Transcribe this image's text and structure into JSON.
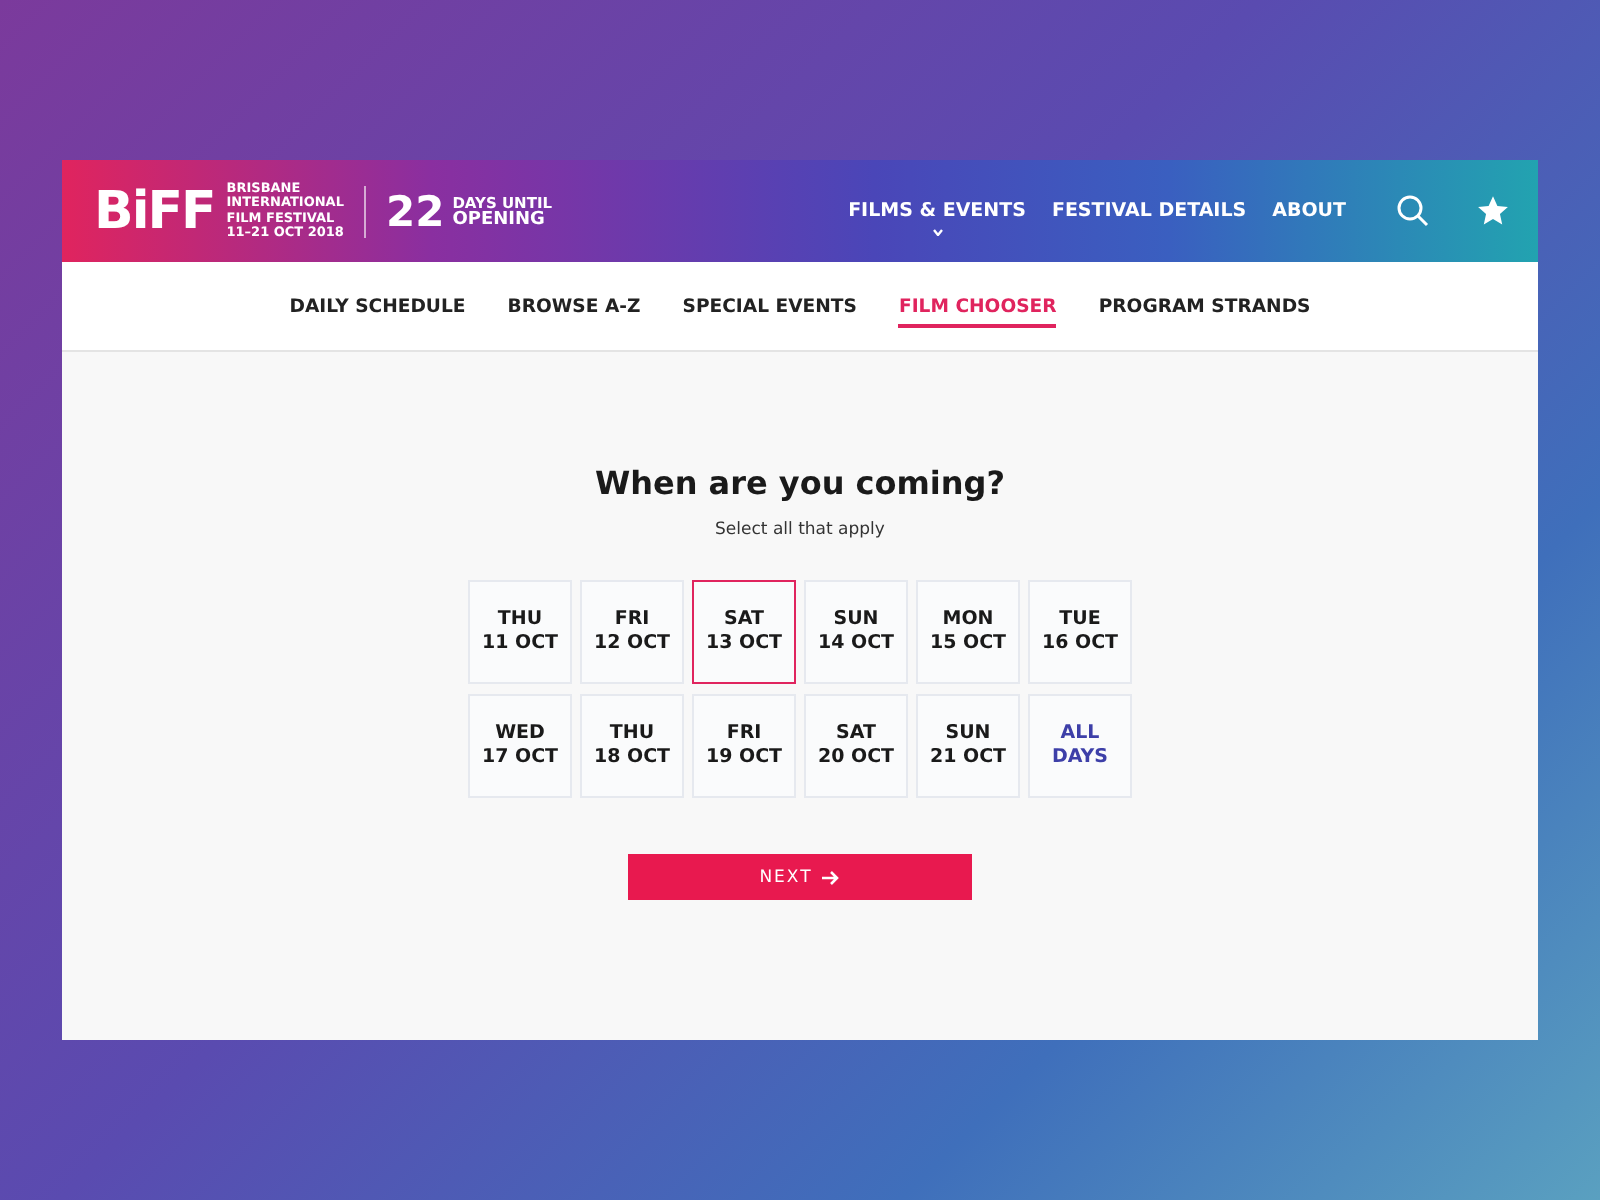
{
  "header": {
    "logo": "BiFF",
    "festival_lines": [
      "BRISBANE",
      "INTERNATIONAL",
      "FILM FESTIVAL",
      "11–21 OCT 2018"
    ],
    "countdown_number": "22",
    "countdown_lines": [
      "DAYS UNTIL",
      "OPENING"
    ],
    "nav": [
      {
        "label": "FILMS & EVENTS",
        "expanded": false
      },
      {
        "label": "FESTIVAL DETAILS"
      },
      {
        "label": "ABOUT"
      }
    ]
  },
  "subnav": [
    {
      "label": "DAILY SCHEDULE",
      "selected": false
    },
    {
      "label": "BROWSE A-Z",
      "selected": false
    },
    {
      "label": "SPECIAL EVENTS",
      "selected": false
    },
    {
      "label": "FILM CHOOSER",
      "selected": true
    },
    {
      "label": "PROGRAM STRANDS",
      "selected": false
    }
  ],
  "chooser": {
    "title": "When are you coming?",
    "subtitle": "Select all that apply",
    "days": [
      {
        "kind": "day",
        "lines": [
          "THU",
          "11 OCT"
        ],
        "selected": false
      },
      {
        "kind": "day",
        "lines": [
          "FRI",
          "12 OCT"
        ],
        "selected": false
      },
      {
        "kind": "day",
        "lines": [
          "SAT",
          "13 OCT"
        ],
        "selected": true
      },
      {
        "kind": "day",
        "lines": [
          "SUN",
          "14 OCT"
        ],
        "selected": false
      },
      {
        "kind": "day",
        "lines": [
          "MON",
          "15 OCT"
        ],
        "selected": false
      },
      {
        "kind": "day",
        "lines": [
          "TUE",
          "16 OCT"
        ],
        "selected": false
      },
      {
        "kind": "day",
        "lines": [
          "WED",
          "17 OCT"
        ],
        "selected": false
      },
      {
        "kind": "day",
        "lines": [
          "THU",
          "18 OCT"
        ],
        "selected": false
      },
      {
        "kind": "day",
        "lines": [
          "FRI",
          "19 OCT"
        ],
        "selected": false
      },
      {
        "kind": "day",
        "lines": [
          "SAT",
          "20 OCT"
        ],
        "selected": false
      },
      {
        "kind": "day",
        "lines": [
          "SUN",
          "21 OCT"
        ],
        "selected": false
      },
      {
        "kind": "all",
        "lines": [
          "ALL",
          "DAYS"
        ],
        "selected": false
      }
    ],
    "button": "NEXT"
  }
}
